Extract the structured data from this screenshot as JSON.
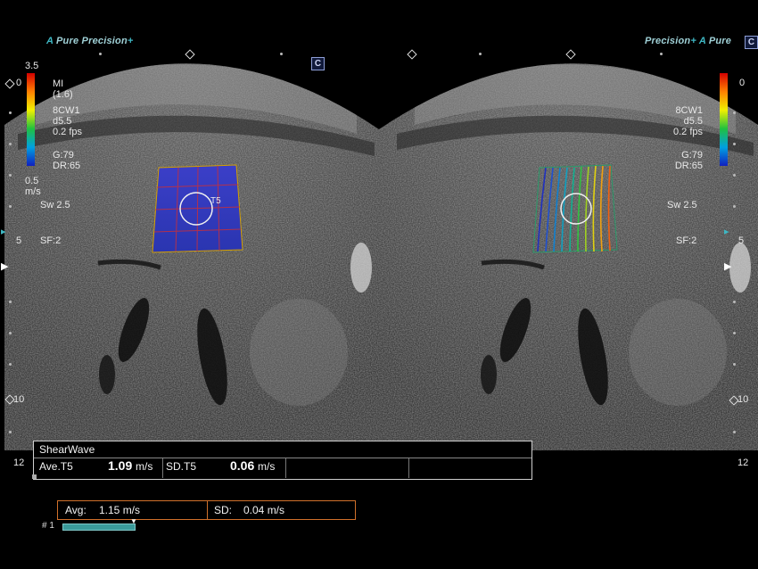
{
  "left_view": {
    "brand_a": "A",
    "brand_pure": "Pure",
    "brand_precision": "Precision",
    "brand_plus": "+",
    "c_badge": "C",
    "scale_max": "3.5",
    "scale_min": "0.5",
    "scale_unit": "m/s",
    "params": [
      "MI",
      "(1.6)",
      "",
      "8CW1",
      "d5.5",
      "0.2 fps",
      "",
      "G:79",
      "DR:65"
    ],
    "sweep": "Sw 2.5",
    "sf": "SF:2",
    "roi_label": "T5",
    "depth_ticks": [
      "0",
      "5",
      "10",
      "12"
    ]
  },
  "right_view": {
    "brand_precision": "Precision",
    "brand_plus": "+",
    "brand_a": "A",
    "brand_pure": "Pure",
    "c_badge": "C",
    "scale_max": "0",
    "params": [
      "8CW1",
      "d5.5",
      "0.2 fps",
      "",
      "G:79",
      "DR:65"
    ],
    "sweep": "Sw 2.5",
    "sf": "SF:2",
    "depth_ticks": [
      "0",
      "5",
      "10",
      "12"
    ]
  },
  "measurement": {
    "title": "ShearWave",
    "ave_label": "Ave.T5",
    "ave_value": "1.09",
    "ave_unit": "m/s",
    "sd_label": "SD.T5",
    "sd_value": "0.06",
    "sd_unit": "m/s"
  },
  "summary": {
    "avg_label": "Avg:",
    "avg_value": "1.15 m/s",
    "sd_label": "SD:",
    "sd_value": "0.04 m/s",
    "index_label": "# 1"
  },
  "colors": {
    "accent_teal": "#3fb8c4",
    "summary_border": "#d0702a",
    "progress_fill": "#3a9a9a"
  }
}
